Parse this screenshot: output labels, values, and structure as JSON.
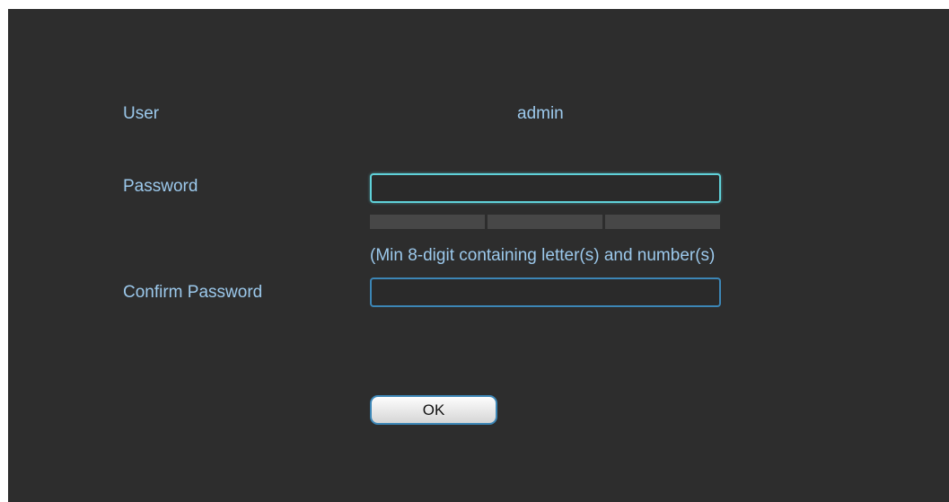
{
  "form": {
    "user_label": "User",
    "user_value": "admin",
    "password_label": "Password",
    "password_value": "",
    "password_strength_segments": 3,
    "password_strength_level": 0,
    "hint": "(Min 8-digit containing letter(s) and number(s)",
    "confirm_label": "Confirm Password",
    "confirm_value": "",
    "ok_label": "OK"
  },
  "colors": {
    "background": "#2d2d2d",
    "label_text": "#9cc9ec",
    "focused_border": "#5fd1d9",
    "idle_border": "#3c86b6",
    "strength_empty": "#474747"
  }
}
